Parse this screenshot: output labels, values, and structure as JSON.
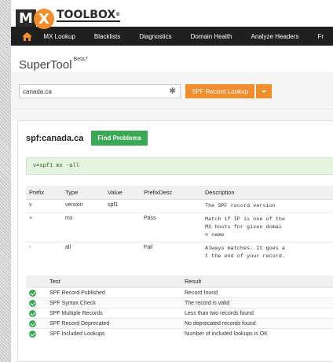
{
  "header": {
    "logo_box": "M",
    "logo_x": "X",
    "logo_text": "TOOLBOX",
    "logo_reg": "®"
  },
  "nav": {
    "home_icon": "home-icon",
    "items": [
      "MX Lookup",
      "Blacklists",
      "Diagnostics",
      "Domain Health",
      "Analyze Headers",
      "Fr"
    ]
  },
  "supertool": {
    "title": "SuperTool",
    "beta": "Beta7"
  },
  "search": {
    "value": "canada.ca",
    "placeholder": "",
    "button_label": "SPF Record Lookup"
  },
  "result": {
    "title": "spf:canada.ca",
    "find_button": "Find Problems",
    "record": "v=spf1 mx -all"
  },
  "spf_table": {
    "headers": [
      "Prefix",
      "Type",
      "Value",
      "PrefixDesc",
      "Description"
    ],
    "rows": [
      {
        "prefix": "v",
        "type": "version",
        "value": "spf1",
        "prefixdesc": "",
        "description": "The SPF record version"
      },
      {
        "prefix": "+",
        "type": "mx",
        "value": "",
        "prefixdesc": "Pass",
        "description": "Match if IP is one of the\nMX hosts for given domai\nn name"
      },
      {
        "prefix": "-",
        "type": "all",
        "value": "",
        "prefixdesc": "Fail",
        "description": "Always matches. It goes a\nt the end of your record."
      }
    ]
  },
  "tests_table": {
    "headers": [
      "",
      "Test",
      "Result"
    ],
    "rows": [
      {
        "test": "SPF Record Published",
        "result": "Record found"
      },
      {
        "test": "SPF Syntax Check",
        "result": "The record is valid"
      },
      {
        "test": "SPF Multiple Records",
        "result": "Less than two records found"
      },
      {
        "test": "SPF Record Deprecated",
        "result": "No deprecated records found"
      },
      {
        "test": "SPF Included Lookups",
        "result": "Number of included lookups is OK"
      }
    ]
  },
  "colors": {
    "nav_bg": "#1f1f1f",
    "accent_orange": "#f28d2b",
    "success_green": "#3aa854",
    "record_bg": "#e5f4df"
  }
}
